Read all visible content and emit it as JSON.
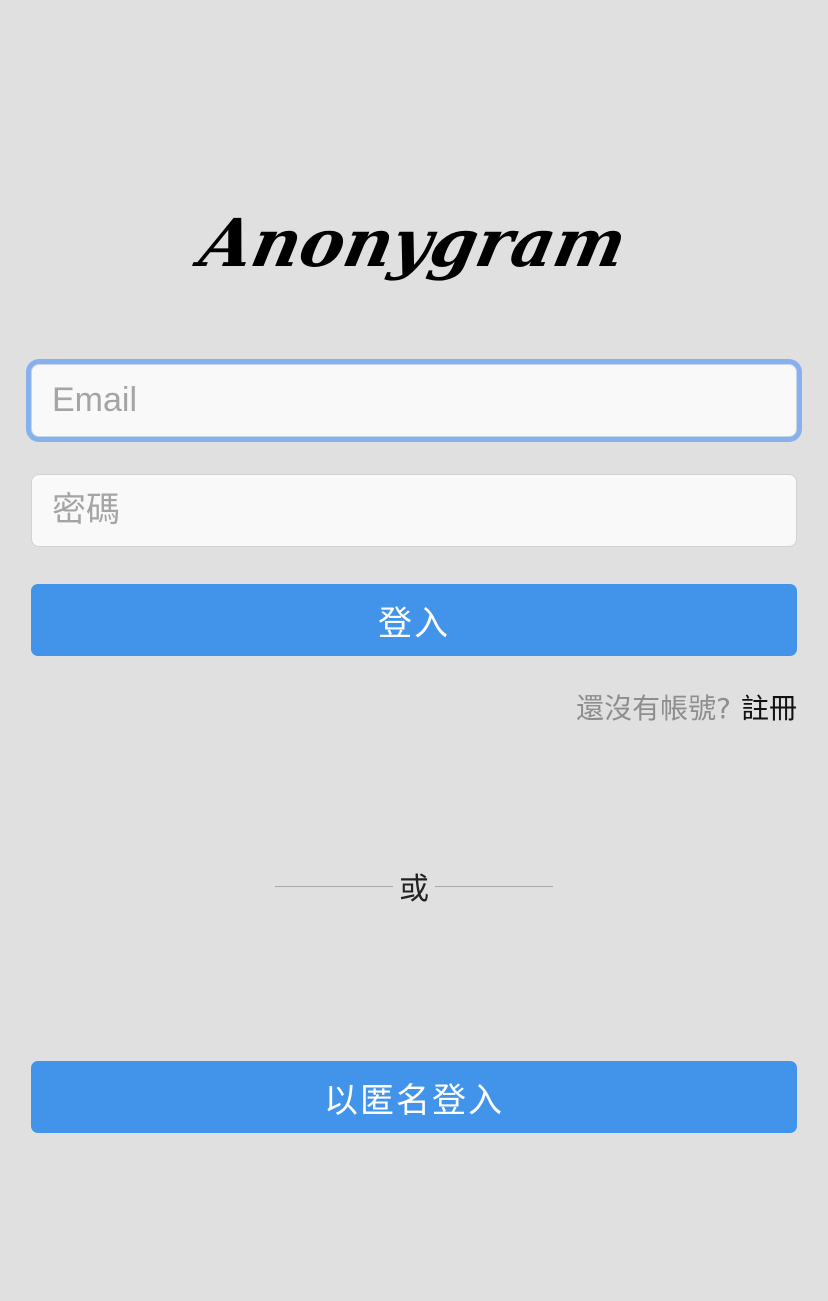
{
  "app": {
    "logo_text": "Anonygram"
  },
  "form": {
    "email_placeholder": "Email",
    "password_placeholder": "密碼",
    "login_label": "登入"
  },
  "signup": {
    "prompt": "還沒有帳號?",
    "link_label": "註冊"
  },
  "divider": {
    "label": "或"
  },
  "anonymous": {
    "login_label": "以匿名登入"
  },
  "colors": {
    "background": "#e0e0e0",
    "primary_button": "#4294eb",
    "focus_ring": "#86b1ec"
  }
}
